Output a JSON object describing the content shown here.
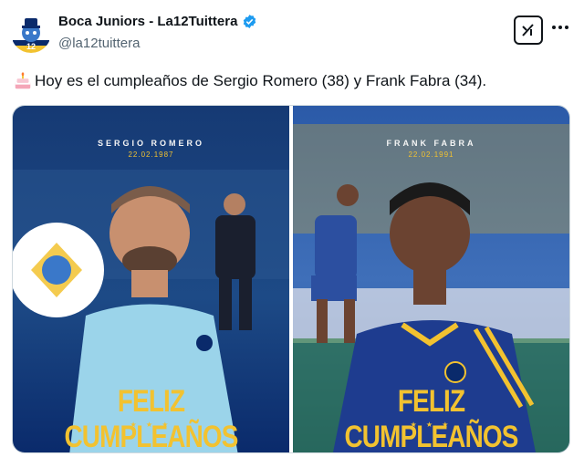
{
  "author": {
    "display_name": "Boca Juniors - La12Tuittera",
    "handle": "@la12tuittera",
    "avatar_icon": "boca-mascot-avatar",
    "verified_icon": "verified-badge-icon"
  },
  "actions": {
    "grok_icon": "grok-icon",
    "more_icon": "more-options-icon"
  },
  "tweet": {
    "emoji_icon": "birthday-cake-icon",
    "text": "Hoy es el cumpleaños de Sergio Romero (38) y Frank Fabra (34)."
  },
  "media": [
    {
      "name": "SERGIO ROMERO",
      "date": "22.02.1987",
      "greeting": "FELIZ CUMPLEAÑOS",
      "stars": "★ ★ ★"
    },
    {
      "name": "FRANK FABRA",
      "date": "22.02.1991",
      "greeting": "FELIZ CUMPLEAÑOS",
      "stars": "★ ★ ★"
    }
  ],
  "colors": {
    "navy": "#0a2a6b",
    "gold": "#f2c230",
    "verified_blue": "#1d9bf0"
  }
}
